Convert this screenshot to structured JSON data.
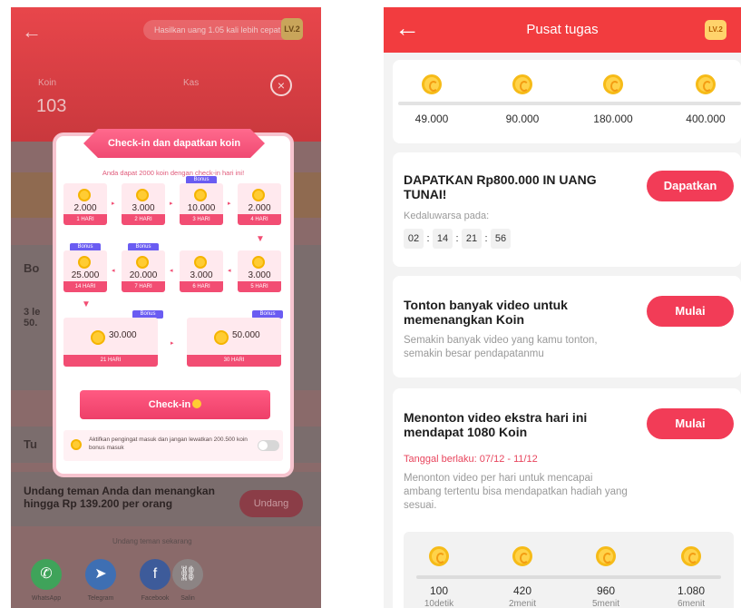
{
  "left": {
    "header": {
      "speed_pill": "Hasilkan uang 1.05 kali lebih cepat",
      "level": "LV.2",
      "koin_label": "Koin",
      "koin_value": "103",
      "kas_label": "Kas"
    },
    "background": {
      "bonus_heading": "Bo",
      "task_snippet": "3 le\n50.",
      "tugas_heading": "Tu",
      "invite_text": "Undang teman Anda dan menangkan hingga Rp 139.200 per orang",
      "invite_button": "Undang",
      "share_hint": "Undang teman sekarang",
      "share": [
        {
          "label": "WhatsApp",
          "color": "#3fa35a",
          "icon": "whatsapp-icon",
          "glyph": "✆"
        },
        {
          "label": "Telegram",
          "color": "#3e6fb3",
          "icon": "telegram-icon",
          "glyph": "➤"
        },
        {
          "label": "Facebook",
          "color": "#3d5b9a",
          "icon": "facebook-icon",
          "glyph": "f"
        },
        {
          "label": "Salin",
          "color": "#8c8484",
          "icon": "link-icon",
          "glyph": "⛓"
        }
      ]
    },
    "modal": {
      "title": "Check-in dan dapatkan koin",
      "subtitle": "Anda dapat 2000 koin dengan check-in hari ini!",
      "days": [
        {
          "amount": "2.000",
          "day": "1 HARI"
        },
        {
          "amount": "3.000",
          "day": "2 HARI"
        },
        {
          "amount": "10.000",
          "day": "3 HARI",
          "bonus": "Bonus"
        },
        {
          "amount": "2.000",
          "day": "4 HARI"
        },
        {
          "amount": "25.000",
          "day": "14 HARI",
          "bonus": "Bonus"
        },
        {
          "amount": "20.000",
          "day": "7 HARI",
          "bonus": "Bonus"
        },
        {
          "amount": "3.000",
          "day": "6 HARI"
        },
        {
          "amount": "3.000",
          "day": "5 HARI"
        }
      ],
      "big_days": [
        {
          "amount": "30.000",
          "day": "21 HARI",
          "bonus": "Bonus"
        },
        {
          "amount": "50.000",
          "day": "30 HARI",
          "bonus": "Bonus"
        }
      ],
      "checkin_button": "Check-in",
      "reminder": "Aktifkan pengingat masuk dan jangan lewatkan 200.500 koin bonus masuk",
      "reminder_on": false,
      "close_label": "×"
    }
  },
  "right": {
    "header": {
      "title": "Pusat tugas",
      "level": "LV.2"
    },
    "milestones_top": [
      "49.000",
      "90.000",
      "180.000",
      "400.000"
    ],
    "cash_task": {
      "title": "DAPATKAN Rp800.000 IN UANG TUNAI!",
      "button": "Dapatkan",
      "expiry_label": "Kedaluwarsa pada:",
      "timer": [
        "02",
        "14",
        "21",
        "56"
      ]
    },
    "video_task": {
      "title": "Tonton banyak video untuk memenangkan Koin",
      "description": "Semakin banyak video yang kamu tonton, semakin besar pendapatanmu",
      "button": "Mulai"
    },
    "extra_task": {
      "title": "Menonton video ekstra hari ini mendapat 1080 Koin",
      "date_range": "Tanggal berlaku: 07/12 - 11/12",
      "description": "Menonton video per hari untuk mencapai ambang tertentu bisa mendapatkan hadiah yang sesuai.",
      "button": "Mulai",
      "milestones": [
        {
          "coins": "100",
          "time": "10detik"
        },
        {
          "coins": "420",
          "time": "2menit"
        },
        {
          "coins": "960",
          "time": "5menit"
        },
        {
          "coins": "1.080",
          "time": "6menit"
        }
      ]
    }
  },
  "colors": {
    "header_red": "#f23c3f",
    "button_pink": "#f23c57",
    "modal_pink": "#f24d73",
    "bonus_purple": "#6a5cf2",
    "coin_gold": "#ffcc33"
  }
}
